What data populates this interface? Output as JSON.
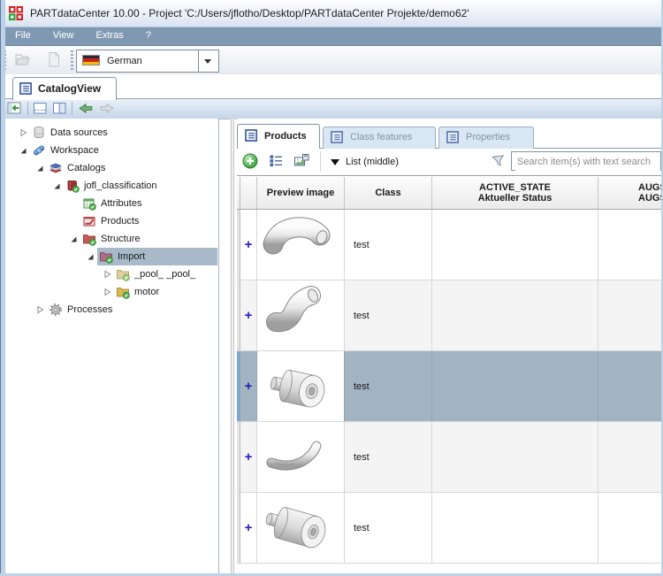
{
  "window": {
    "title": "PARTdataCenter 10.00 - Project 'C:/Users/jflotho/Desktop/PARTdataCenter Projekte/demo62'"
  },
  "menu_bar": {
    "items": [
      {
        "label": "File"
      },
      {
        "label": "View"
      },
      {
        "label": "Extras"
      },
      {
        "label": "?"
      }
    ]
  },
  "main_toolbar": {
    "language_selector": {
      "value": "German",
      "flag_icon": "german-flag"
    },
    "icons": [
      "open-project",
      "new-document"
    ]
  },
  "view_tabs": {
    "catalog_view": {
      "label": "CatalogView"
    }
  },
  "panel_toolbar": {
    "icons": [
      "collapse-sidebar",
      "layout-horizontal",
      "layout-vertical",
      "nav-back",
      "nav-forward"
    ]
  },
  "tree": {
    "items": [
      {
        "label": "Data sources",
        "icon": "database",
        "state": "collapsed",
        "selected": false
      },
      {
        "label": "Workspace",
        "icon": "workspace",
        "state": "expanded",
        "selected": false
      },
      {
        "label": "Catalogs",
        "icon": "catalog-stack",
        "state": "expanded",
        "selected": false
      },
      {
        "label": "jofl_classification",
        "icon": "catalog-book",
        "state": "expanded",
        "selected": false
      },
      {
        "label": "Attributes",
        "icon": "attributes-table",
        "state": "leaf",
        "selected": false
      },
      {
        "label": "Products",
        "icon": "products",
        "state": "leaf",
        "selected": false
      },
      {
        "label": "Structure",
        "icon": "folder-red",
        "state": "expanded",
        "selected": false
      },
      {
        "label": "Import",
        "icon": "folder-mauve",
        "state": "expanded",
        "selected": true
      },
      {
        "label": "_pool_ _pool_",
        "icon": "folder-tan",
        "state": "collapsed",
        "selected": false
      },
      {
        "label": "motor",
        "icon": "folder-yellow",
        "state": "collapsed",
        "selected": false
      },
      {
        "label": "Processes",
        "icon": "gear",
        "state": "collapsed",
        "selected": false
      }
    ]
  },
  "right_panel": {
    "tabs": [
      {
        "label": "Products",
        "active": true
      },
      {
        "label": "Class features",
        "active": false
      },
      {
        "label": "Properties",
        "active": false
      }
    ],
    "toolbar": {
      "icons": [
        "add-item",
        "numbered-list",
        "image-export"
      ],
      "view_mode_label": "List (middle)",
      "search_placeholder": "Search item(s) with text search",
      "search_value": ""
    },
    "table": {
      "expand_symbol": "+",
      "columns": [
        {
          "label": "Preview image"
        },
        {
          "label": "Class"
        },
        {
          "label": "ACTIVE_STATE",
          "sublabel": "Aktueller Status"
        },
        {
          "label": "AUGS",
          "sublabel": "AUGS",
          "clipped": true
        }
      ],
      "rows": [
        {
          "class_name": "test",
          "preview": "bent-tube",
          "selected": false
        },
        {
          "class_name": "test",
          "preview": "s-curved-tube",
          "selected": false
        },
        {
          "class_name": "test",
          "preview": "hub-cylinder",
          "selected": true
        },
        {
          "class_name": "test",
          "preview": "curved-handle",
          "selected": false
        },
        {
          "class_name": "test",
          "preview": "long-cylinder",
          "selected": false
        }
      ]
    }
  },
  "colors": {
    "selection_row": "#a2b3c2",
    "tree_selection": "#a8bac9",
    "menu_bar": "#8098b2",
    "accent_blue": "#2a4a9a",
    "plus_blue": "#2020c0",
    "tab_inactive": "#d9e6f3",
    "check_badge_green": "#4db04d"
  }
}
